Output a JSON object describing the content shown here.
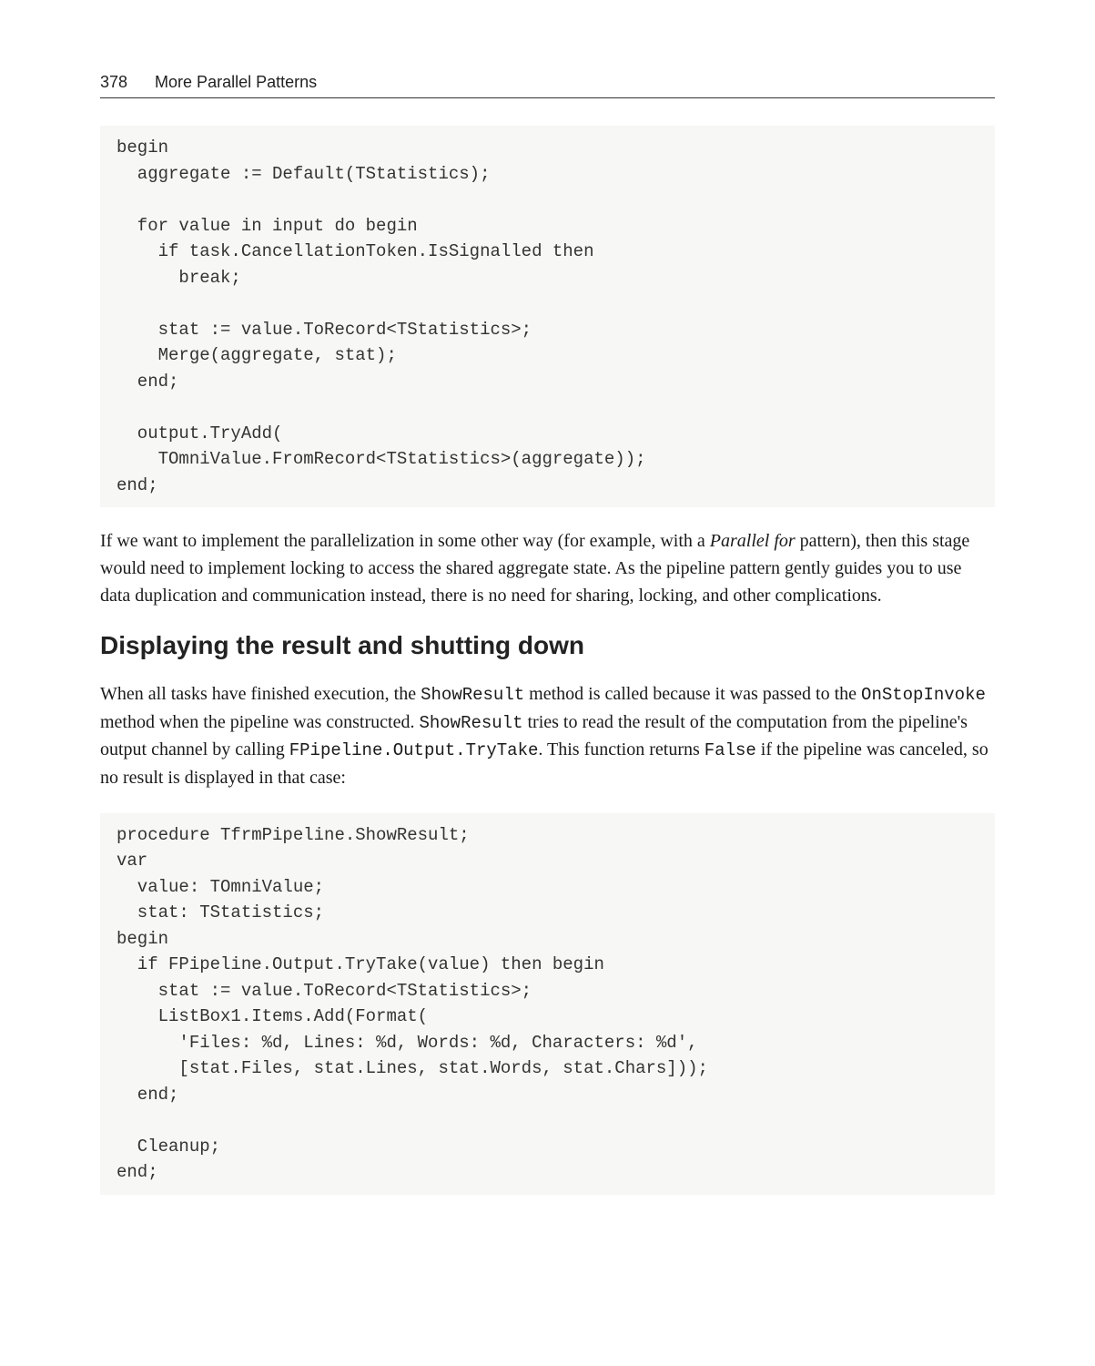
{
  "header": {
    "page_number": "378",
    "chapter_title": "More Parallel Patterns"
  },
  "code_block_1": "begin\n  aggregate := Default(TStatistics);\n\n  for value in input do begin\n    if task.CancellationToken.IsSignalled then\n      break;\n\n    stat := value.ToRecord<TStatistics>;\n    Merge(aggregate, stat);\n  end;\n\n  output.TryAdd(\n    TOmniValue.FromRecord<TStatistics>(aggregate));\nend;",
  "paragraph_1_parts": {
    "p1": "If we want to implement the parallelization in some other way (for example, with a ",
    "p2": "Parallel for",
    "p3": " pattern), then this stage would need to implement locking to access the shared aggregate state. As the pipeline pattern gently guides you to use data duplication and communication instead, there is no need for sharing, locking, and other complications."
  },
  "section_heading": "Displaying the result and shutting down",
  "paragraph_2_parts": {
    "p1": "When all tasks have finished execution, the ",
    "p2": "ShowResult",
    "p3": " method is called because it was passed to the ",
    "p4": "OnStopInvoke",
    "p5": " method when the pipeline was constructed. ",
    "p6": "ShowResult",
    "p7": " tries to read the result of the computation from the pipeline's output channel by calling ",
    "p8": "FPipeline.Output.TryTake",
    "p9": ". This function returns ",
    "p10": "False",
    "p11": " if the pipeline was canceled, so no result is displayed in that case:"
  },
  "code_block_2": "procedure TfrmPipeline.ShowResult;\nvar\n  value: TOmniValue;\n  stat: TStatistics;\nbegin\n  if FPipeline.Output.TryTake(value) then begin\n    stat := value.ToRecord<TStatistics>;\n    ListBox1.Items.Add(Format(\n      'Files: %d, Lines: %d, Words: %d, Characters: %d',\n      [stat.Files, stat.Lines, stat.Words, stat.Chars]));\n  end;\n\n  Cleanup;\nend;"
}
